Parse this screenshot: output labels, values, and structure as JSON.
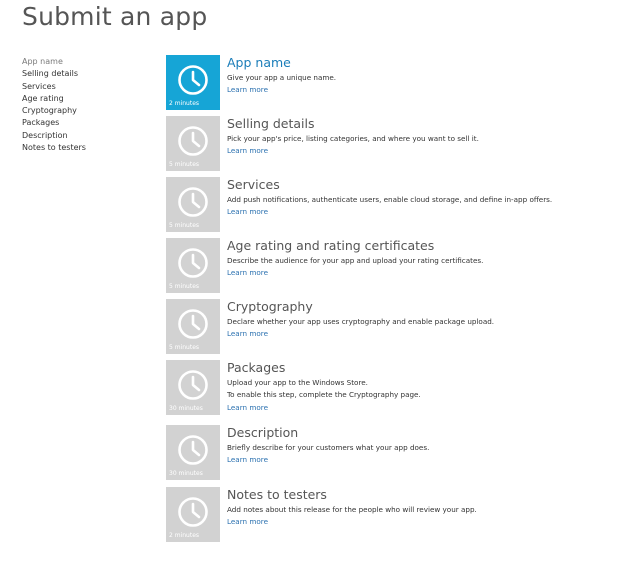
{
  "page": {
    "title": "Submit an app"
  },
  "sidebar": {
    "items": [
      {
        "label": "App name"
      },
      {
        "label": "Selling details"
      },
      {
        "label": "Services"
      },
      {
        "label": "Age rating"
      },
      {
        "label": "Cryptography"
      },
      {
        "label": "Packages"
      },
      {
        "label": "Description"
      },
      {
        "label": "Notes to testers"
      }
    ]
  },
  "steps": [
    {
      "title": "App name",
      "duration": "2 minutes",
      "lines": [
        "Give your app a unique name."
      ],
      "link": "Learn more",
      "icon": "clock-icon"
    },
    {
      "title": "Selling details",
      "duration": "5 minutes",
      "lines": [
        "Pick your app's price, listing categories, and where you want to sell it."
      ],
      "link": "Learn more",
      "icon": "clock-icon"
    },
    {
      "title": "Services",
      "duration": "5 minutes",
      "lines": [
        "Add push notifications, authenticate users, enable cloud storage, and define in-app offers."
      ],
      "link": "Learn more",
      "icon": "clock-icon"
    },
    {
      "title": "Age rating and rating certificates",
      "duration": "5 minutes",
      "lines": [
        "Describe the audience for your app and upload your rating certificates."
      ],
      "link": "Learn more",
      "icon": "clock-icon"
    },
    {
      "title": "Cryptography",
      "duration": "5 minutes",
      "lines": [
        "Declare whether your app uses cryptography and enable package upload."
      ],
      "link": "Learn more",
      "icon": "clock-icon"
    },
    {
      "title": "Packages",
      "duration": "30 minutes",
      "lines": [
        "Upload your app to the Windows Store.",
        "To enable this step, complete the Cryptography page."
      ],
      "link": "Learn more",
      "icon": "clock-icon"
    },
    {
      "title": "Description",
      "duration": "30 minutes",
      "lines": [
        "Briefly describe for your customers what your app does."
      ],
      "link": "Learn more",
      "icon": "clock-icon"
    },
    {
      "title": "Notes to testers",
      "duration": "2 minutes",
      "lines": [
        "Add notes about this release for the people who will review your app."
      ],
      "link": "Learn more",
      "icon": "clock-icon"
    }
  ],
  "colors": {
    "accent": "#16a5d6",
    "tile_inactive": "#d2d2d2",
    "link": "#2b71b0"
  }
}
